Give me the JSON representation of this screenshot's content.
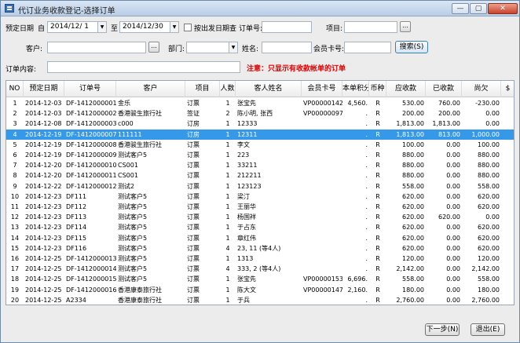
{
  "window": {
    "title": "代订业务收款登记-选择订单",
    "min_label": "—",
    "max_label": "▢",
    "close_label": "✕"
  },
  "filters": {
    "date_label": "预定日期",
    "from_label": "自",
    "date_from": "2014/12/ 1",
    "to_label": "至",
    "date_to": "2014/12/30",
    "by_departure_label": "按出发日期查",
    "order_no_label": "订单号:",
    "order_no_value": "",
    "item_label": "项目:",
    "item_value": "",
    "customer_label": "客户:",
    "customer_value": "",
    "dept_label": "部门:",
    "dept_value": "",
    "name_label": "姓名:",
    "name_value": "",
    "member_card_label": "会员卡号:",
    "member_card_value": "",
    "search_label": "搜索(S)",
    "content_label": "订单内容:",
    "content_value": "",
    "ellipsis": "...",
    "note": "注意：只显示有收款帐单的订单"
  },
  "table": {
    "columns": [
      "NO",
      "预定日期",
      "订单号",
      "客户",
      "项目",
      "人数",
      "客人姓名",
      "会员卡号",
      "本单积分",
      "币种",
      "应收款",
      "已收款",
      "尚欠",
      "$"
    ],
    "rows": [
      {
        "no": "1",
        "date": "2014-12-03",
        "order": "DF-1412000001",
        "customer": "金乐",
        "item": "订票",
        "pax": "1",
        "guest": "张宝先",
        "card": "VP00000142",
        "points": "4,560.",
        "cur": "R",
        "due": "530.00",
        "paid": "760.00",
        "owe": "-230.00"
      },
      {
        "no": "2",
        "date": "2014-12-03",
        "order": "DF-1412000002",
        "customer": "香港骏生旅行社",
        "item": "签证",
        "pax": "2",
        "guest": "陈小明, 张西",
        "card": "VP00000097",
        "points": ".",
        "cur": "R",
        "due": "200.00",
        "paid": "200.00",
        "owe": "0.00"
      },
      {
        "no": "3",
        "date": "2014-12-08",
        "order": "DF-1412000003",
        "customer": "c000",
        "item": "订房",
        "pax": "1",
        "guest": "12333",
        "card": "",
        "points": ".",
        "cur": "R",
        "due": "1,813.00",
        "paid": "1,813.00",
        "owe": "0.00"
      },
      {
        "no": "4",
        "date": "2014-12-19",
        "order": "DF-1412000007",
        "customer": "111111",
        "item": "订房",
        "pax": "1",
        "guest": "12311",
        "card": "",
        "points": ".",
        "cur": "R",
        "due": "1,813.00",
        "paid": "813.00",
        "owe": "1,000.00"
      },
      {
        "no": "5",
        "date": "2014-12-19",
        "order": "DF-1412000008",
        "customer": "香港骏生旅行社",
        "item": "订票",
        "pax": "1",
        "guest": "李文",
        "card": "",
        "points": ".",
        "cur": "R",
        "due": "100.00",
        "paid": "0.00",
        "owe": "100.00"
      },
      {
        "no": "6",
        "date": "2014-12-19",
        "order": "DF-1412000009",
        "customer": "测试客户5",
        "item": "订票",
        "pax": "1",
        "guest": "223",
        "card": "",
        "points": ".",
        "cur": "R",
        "due": "880.00",
        "paid": "0.00",
        "owe": "880.00"
      },
      {
        "no": "7",
        "date": "2014-12-20",
        "order": "DF-1412000010",
        "customer": "CS001",
        "item": "订票",
        "pax": "1",
        "guest": "33211",
        "card": "",
        "points": ".",
        "cur": "R",
        "due": "880.00",
        "paid": "0.00",
        "owe": "880.00"
      },
      {
        "no": "8",
        "date": "2014-12-20",
        "order": "DF-1412000011",
        "customer": "CS001",
        "item": "订票",
        "pax": "1",
        "guest": "212211",
        "card": "",
        "points": ".",
        "cur": "R",
        "due": "880.00",
        "paid": "0.00",
        "owe": "880.00"
      },
      {
        "no": "9",
        "date": "2014-12-22",
        "order": "DF-1412000012",
        "customer": "测试2",
        "item": "订票",
        "pax": "1",
        "guest": "123123",
        "card": "",
        "points": ".",
        "cur": "R",
        "due": "558.00",
        "paid": "0.00",
        "owe": "558.00"
      },
      {
        "no": "10",
        "date": "2014-12-23",
        "order": "DF111",
        "customer": "测试客户5",
        "item": "订票",
        "pax": "1",
        "guest": "梁汀",
        "card": "",
        "points": ".",
        "cur": "R",
        "due": "620.00",
        "paid": "0.00",
        "owe": "620.00"
      },
      {
        "no": "11",
        "date": "2014-12-23",
        "order": "DF112",
        "customer": "测试客户5",
        "item": "订票",
        "pax": "1",
        "guest": "王丽华",
        "card": "",
        "points": ".",
        "cur": "R",
        "due": "620.00",
        "paid": "0.00",
        "owe": "620.00"
      },
      {
        "no": "12",
        "date": "2014-12-23",
        "order": "DF113",
        "customer": "测试客户5",
        "item": "订票",
        "pax": "1",
        "guest": "杨国祥",
        "card": "",
        "points": ".",
        "cur": "R",
        "due": "620.00",
        "paid": "620.00",
        "owe": "0.00"
      },
      {
        "no": "13",
        "date": "2014-12-23",
        "order": "DF114",
        "customer": "测试客户5",
        "item": "订票",
        "pax": "1",
        "guest": "于占东",
        "card": "",
        "points": ".",
        "cur": "R",
        "due": "620.00",
        "paid": "0.00",
        "owe": "620.00"
      },
      {
        "no": "14",
        "date": "2014-12-23",
        "order": "DF115",
        "customer": "测试客户5",
        "item": "订票",
        "pax": "1",
        "guest": "章红伟",
        "card": "",
        "points": ".",
        "cur": "R",
        "due": "620.00",
        "paid": "0.00",
        "owe": "620.00"
      },
      {
        "no": "15",
        "date": "2014-12-23",
        "order": "DF116",
        "customer": "测试客户5",
        "item": "订票",
        "pax": "4",
        "guest": "23, 11 (等4人)",
        "card": "",
        "points": ".",
        "cur": "R",
        "due": "620.00",
        "paid": "0.00",
        "owe": "620.00"
      },
      {
        "no": "16",
        "date": "2014-12-25",
        "order": "DF-1412000013",
        "customer": "测试客户5",
        "item": "订票",
        "pax": "1",
        "guest": "1313",
        "card": "",
        "points": ".",
        "cur": "R",
        "due": "120.00",
        "paid": "0.00",
        "owe": "120.00"
      },
      {
        "no": "17",
        "date": "2014-12-25",
        "order": "DF-1412000014",
        "customer": "测试客户5",
        "item": "订票",
        "pax": "4",
        "guest": "333, 2 (等4人)",
        "card": "",
        "points": ".",
        "cur": "R",
        "due": "2,142.00",
        "paid": "0.00",
        "owe": "2,142.00"
      },
      {
        "no": "18",
        "date": "2014-12-25",
        "order": "DF-1412000015",
        "customer": "测试客户5",
        "item": "订票",
        "pax": "1",
        "guest": "张宝先",
        "card": "VP00000153",
        "points": "6,696.",
        "cur": "R",
        "due": "558.00",
        "paid": "0.00",
        "owe": "558.00"
      },
      {
        "no": "19",
        "date": "2014-12-25",
        "order": "DF-1412000016",
        "customer": "香港康泰旅行社",
        "item": "订票",
        "pax": "1",
        "guest": "陈大文",
        "card": "VP00000147",
        "points": "2,160.",
        "cur": "R",
        "due": "180.00",
        "paid": "0.00",
        "owe": "180.00"
      },
      {
        "no": "20",
        "date": "2014-12-25",
        "order": "A2334",
        "customer": "香港康泰旅行社",
        "item": "订票",
        "pax": "1",
        "guest": "于兵",
        "card": "",
        "points": ".",
        "cur": "R",
        "due": "2,760.00",
        "paid": "0.00",
        "owe": "2,760.00"
      }
    ],
    "selected_index": 3
  },
  "footer": {
    "next_label": "下一步(N)",
    "exit_label": "退出(E)"
  }
}
